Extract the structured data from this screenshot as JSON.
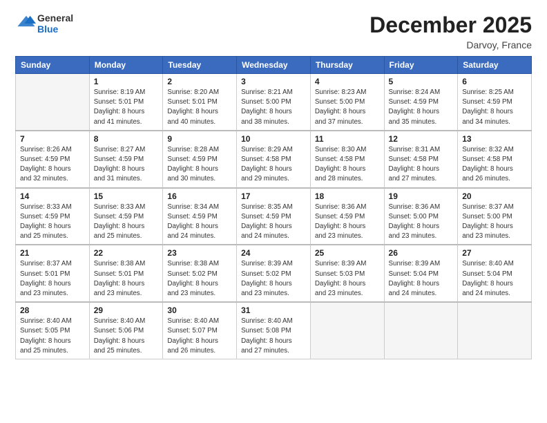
{
  "header": {
    "logo_general": "General",
    "logo_blue": "Blue",
    "month_title": "December 2025",
    "location": "Darvoy, France"
  },
  "weekdays": [
    "Sunday",
    "Monday",
    "Tuesday",
    "Wednesday",
    "Thursday",
    "Friday",
    "Saturday"
  ],
  "weeks": [
    [
      {
        "day": "",
        "empty": true
      },
      {
        "day": "1",
        "sunrise": "Sunrise: 8:19 AM",
        "sunset": "Sunset: 5:01 PM",
        "daylight": "Daylight: 8 hours and 41 minutes."
      },
      {
        "day": "2",
        "sunrise": "Sunrise: 8:20 AM",
        "sunset": "Sunset: 5:01 PM",
        "daylight": "Daylight: 8 hours and 40 minutes."
      },
      {
        "day": "3",
        "sunrise": "Sunrise: 8:21 AM",
        "sunset": "Sunset: 5:00 PM",
        "daylight": "Daylight: 8 hours and 38 minutes."
      },
      {
        "day": "4",
        "sunrise": "Sunrise: 8:23 AM",
        "sunset": "Sunset: 5:00 PM",
        "daylight": "Daylight: 8 hours and 37 minutes."
      },
      {
        "day": "5",
        "sunrise": "Sunrise: 8:24 AM",
        "sunset": "Sunset: 4:59 PM",
        "daylight": "Daylight: 8 hours and 35 minutes."
      },
      {
        "day": "6",
        "sunrise": "Sunrise: 8:25 AM",
        "sunset": "Sunset: 4:59 PM",
        "daylight": "Daylight: 8 hours and 34 minutes."
      }
    ],
    [
      {
        "day": "7",
        "sunrise": "Sunrise: 8:26 AM",
        "sunset": "Sunset: 4:59 PM",
        "daylight": "Daylight: 8 hours and 32 minutes."
      },
      {
        "day": "8",
        "sunrise": "Sunrise: 8:27 AM",
        "sunset": "Sunset: 4:59 PM",
        "daylight": "Daylight: 8 hours and 31 minutes."
      },
      {
        "day": "9",
        "sunrise": "Sunrise: 8:28 AM",
        "sunset": "Sunset: 4:59 PM",
        "daylight": "Daylight: 8 hours and 30 minutes."
      },
      {
        "day": "10",
        "sunrise": "Sunrise: 8:29 AM",
        "sunset": "Sunset: 4:58 PM",
        "daylight": "Daylight: 8 hours and 29 minutes."
      },
      {
        "day": "11",
        "sunrise": "Sunrise: 8:30 AM",
        "sunset": "Sunset: 4:58 PM",
        "daylight": "Daylight: 8 hours and 28 minutes."
      },
      {
        "day": "12",
        "sunrise": "Sunrise: 8:31 AM",
        "sunset": "Sunset: 4:58 PM",
        "daylight": "Daylight: 8 hours and 27 minutes."
      },
      {
        "day": "13",
        "sunrise": "Sunrise: 8:32 AM",
        "sunset": "Sunset: 4:58 PM",
        "daylight": "Daylight: 8 hours and 26 minutes."
      }
    ],
    [
      {
        "day": "14",
        "sunrise": "Sunrise: 8:33 AM",
        "sunset": "Sunset: 4:59 PM",
        "daylight": "Daylight: 8 hours and 25 minutes."
      },
      {
        "day": "15",
        "sunrise": "Sunrise: 8:33 AM",
        "sunset": "Sunset: 4:59 PM",
        "daylight": "Daylight: 8 hours and 25 minutes."
      },
      {
        "day": "16",
        "sunrise": "Sunrise: 8:34 AM",
        "sunset": "Sunset: 4:59 PM",
        "daylight": "Daylight: 8 hours and 24 minutes."
      },
      {
        "day": "17",
        "sunrise": "Sunrise: 8:35 AM",
        "sunset": "Sunset: 4:59 PM",
        "daylight": "Daylight: 8 hours and 24 minutes."
      },
      {
        "day": "18",
        "sunrise": "Sunrise: 8:36 AM",
        "sunset": "Sunset: 4:59 PM",
        "daylight": "Daylight: 8 hours and 23 minutes."
      },
      {
        "day": "19",
        "sunrise": "Sunrise: 8:36 AM",
        "sunset": "Sunset: 5:00 PM",
        "daylight": "Daylight: 8 hours and 23 minutes."
      },
      {
        "day": "20",
        "sunrise": "Sunrise: 8:37 AM",
        "sunset": "Sunset: 5:00 PM",
        "daylight": "Daylight: 8 hours and 23 minutes."
      }
    ],
    [
      {
        "day": "21",
        "sunrise": "Sunrise: 8:37 AM",
        "sunset": "Sunset: 5:01 PM",
        "daylight": "Daylight: 8 hours and 23 minutes."
      },
      {
        "day": "22",
        "sunrise": "Sunrise: 8:38 AM",
        "sunset": "Sunset: 5:01 PM",
        "daylight": "Daylight: 8 hours and 23 minutes."
      },
      {
        "day": "23",
        "sunrise": "Sunrise: 8:38 AM",
        "sunset": "Sunset: 5:02 PM",
        "daylight": "Daylight: 8 hours and 23 minutes."
      },
      {
        "day": "24",
        "sunrise": "Sunrise: 8:39 AM",
        "sunset": "Sunset: 5:02 PM",
        "daylight": "Daylight: 8 hours and 23 minutes."
      },
      {
        "day": "25",
        "sunrise": "Sunrise: 8:39 AM",
        "sunset": "Sunset: 5:03 PM",
        "daylight": "Daylight: 8 hours and 23 minutes."
      },
      {
        "day": "26",
        "sunrise": "Sunrise: 8:39 AM",
        "sunset": "Sunset: 5:04 PM",
        "daylight": "Daylight: 8 hours and 24 minutes."
      },
      {
        "day": "27",
        "sunrise": "Sunrise: 8:40 AM",
        "sunset": "Sunset: 5:04 PM",
        "daylight": "Daylight: 8 hours and 24 minutes."
      }
    ],
    [
      {
        "day": "28",
        "sunrise": "Sunrise: 8:40 AM",
        "sunset": "Sunset: 5:05 PM",
        "daylight": "Daylight: 8 hours and 25 minutes."
      },
      {
        "day": "29",
        "sunrise": "Sunrise: 8:40 AM",
        "sunset": "Sunset: 5:06 PM",
        "daylight": "Daylight: 8 hours and 25 minutes."
      },
      {
        "day": "30",
        "sunrise": "Sunrise: 8:40 AM",
        "sunset": "Sunset: 5:07 PM",
        "daylight": "Daylight: 8 hours and 26 minutes."
      },
      {
        "day": "31",
        "sunrise": "Sunrise: 8:40 AM",
        "sunset": "Sunset: 5:08 PM",
        "daylight": "Daylight: 8 hours and 27 minutes."
      },
      {
        "day": "",
        "empty": true
      },
      {
        "day": "",
        "empty": true
      },
      {
        "day": "",
        "empty": true
      }
    ]
  ]
}
